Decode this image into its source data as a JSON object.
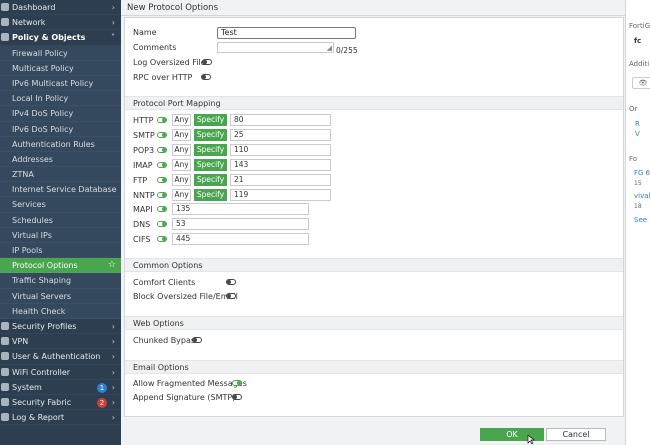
{
  "sidebar": {
    "items": [
      {
        "label": "Dashboard",
        "type": "top",
        "chevron": ">"
      },
      {
        "label": "Network",
        "type": "top",
        "chevron": ">"
      },
      {
        "label": "Policy & Objects",
        "type": "top-open",
        "chevron": "v"
      },
      {
        "label": "Firewall Policy",
        "type": "sub"
      },
      {
        "label": "Multicast Policy",
        "type": "sub"
      },
      {
        "label": "IPv6 Multicast Policy",
        "type": "sub"
      },
      {
        "label": "Local In Policy",
        "type": "sub"
      },
      {
        "label": "IPv4 DoS Policy",
        "type": "sub"
      },
      {
        "label": "IPv6 DoS Policy",
        "type": "sub"
      },
      {
        "label": "Authentication Rules",
        "type": "sub"
      },
      {
        "label": "Addresses",
        "type": "sub"
      },
      {
        "label": "ZTNA",
        "type": "sub"
      },
      {
        "label": "Internet Service Database",
        "type": "sub"
      },
      {
        "label": "Services",
        "type": "sub"
      },
      {
        "label": "Schedules",
        "type": "sub"
      },
      {
        "label": "Virtual IPs",
        "type": "sub"
      },
      {
        "label": "IP Pools",
        "type": "sub"
      },
      {
        "label": "Protocol Options",
        "type": "active"
      },
      {
        "label": "Traffic Shaping",
        "type": "sub"
      },
      {
        "label": "Virtual Servers",
        "type": "sub"
      },
      {
        "label": "Health Check",
        "type": "sub"
      },
      {
        "label": "Security Profiles",
        "type": "top",
        "chevron": ">"
      },
      {
        "label": "VPN",
        "type": "top",
        "chevron": ">"
      },
      {
        "label": "User & Authentication",
        "type": "top",
        "chevron": ">"
      },
      {
        "label": "WiFi Controller",
        "type": "top",
        "chevron": ">"
      },
      {
        "label": "System",
        "type": "top",
        "chevron": ">",
        "badge": "1",
        "badge_color": "blue"
      },
      {
        "label": "Security Fabric",
        "type": "top",
        "chevron": ">",
        "badge": "2",
        "badge_color": "red"
      },
      {
        "label": "Log & Report",
        "type": "top",
        "chevron": ">"
      }
    ]
  },
  "dialog": {
    "title": "New Protocol Options",
    "name_label": "Name",
    "name_value": "Test",
    "comments_label": "Comments",
    "comments_count": "0/255",
    "log_oversized_label": "Log Oversized Files",
    "rpc_over_http_label": "RPC over HTTP",
    "port_mapping_title": "Protocol Port Mapping",
    "any_label": "Any",
    "specify_label": "Specify",
    "protocols_with_any": [
      {
        "name": "HTTP",
        "port": "80"
      },
      {
        "name": "SMTP",
        "port": "25"
      },
      {
        "name": "POP3",
        "port": "110"
      },
      {
        "name": "IMAP",
        "port": "143"
      },
      {
        "name": "FTP",
        "port": "21"
      },
      {
        "name": "NNTP",
        "port": "119"
      }
    ],
    "protocols_plain": [
      {
        "name": "MAPI",
        "port": "135"
      },
      {
        "name": "DNS",
        "port": "53"
      },
      {
        "name": "CIFS",
        "port": "445"
      }
    ],
    "common_options_title": "Common Options",
    "comfort_clients_label": "Comfort Clients",
    "block_oversized_label": "Block Oversized File/Email",
    "web_options_title": "Web Options",
    "chunked_bypass_label": "Chunked Bypass",
    "email_options_title": "Email Options",
    "allow_fragmented_label": "Allow Fragmented Messages",
    "append_signature_label": "Append Signature (SMTP)"
  },
  "right_panel": {
    "fortigate_title": "FortiG",
    "fortigate_device": "fc",
    "additional_title": "Additi",
    "online_help_title": "Or",
    "link_r": "R",
    "link_v": "V",
    "forum_title": "Fo",
    "forum_item_1": "FG 6",
    "forum_meta_1": "15",
    "forum_item_2": "vivald",
    "forum_meta_2": "18",
    "see_more": "See M"
  },
  "buttons": {
    "ok": "OK",
    "cancel": "Cancel"
  },
  "colors": {
    "sidebar_bg": "#2c3e50",
    "accent_green": "#49a54e",
    "badge_blue": "#2f80d1",
    "badge_red": "#d13c32"
  }
}
